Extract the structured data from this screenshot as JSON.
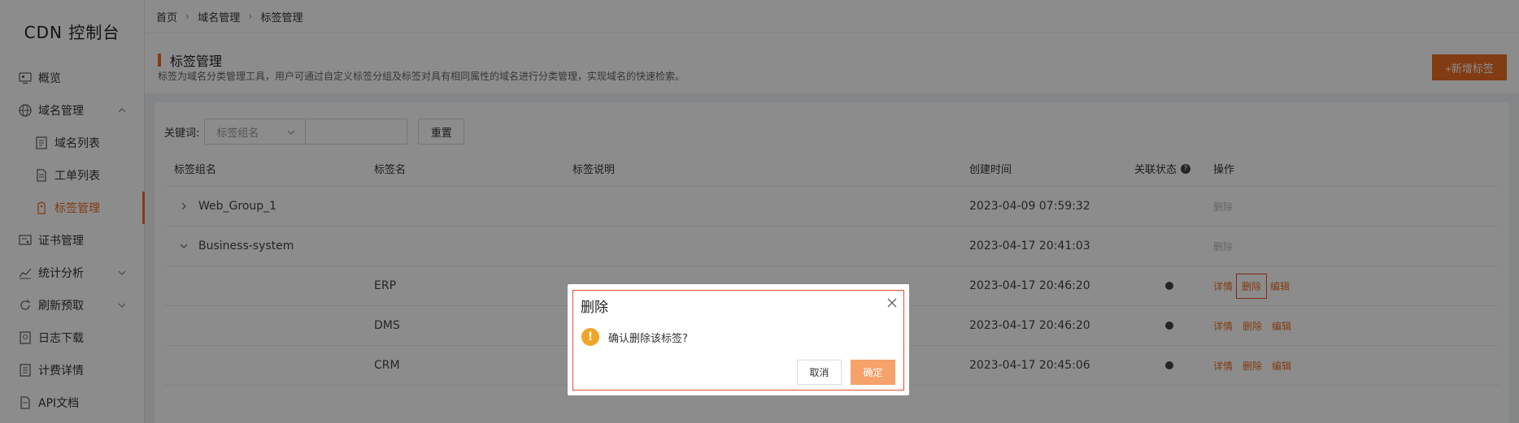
{
  "brand": "CDN 控制台",
  "sidebar": {
    "items": [
      {
        "label": "概览",
        "icon": "monitor-icon"
      },
      {
        "label": "域名管理",
        "icon": "globe-icon"
      },
      {
        "label": "域名列表",
        "icon": "list-icon"
      },
      {
        "label": "工单列表",
        "icon": "document-icon"
      },
      {
        "label": "标签管理",
        "icon": "tag-icon"
      },
      {
        "label": "证书管理",
        "icon": "certificate-icon"
      },
      {
        "label": "统计分析",
        "icon": "chart-icon"
      },
      {
        "label": "刷新预取",
        "icon": "refresh-icon"
      },
      {
        "label": "日志下载",
        "icon": "log-icon"
      },
      {
        "label": "计费详情",
        "icon": "billing-icon"
      },
      {
        "label": "API文档",
        "icon": "api-doc-icon"
      }
    ]
  },
  "breadcrumb": [
    "首页",
    "域名管理",
    "标签管理"
  ],
  "header": {
    "title": "标签管理",
    "description": "标签为域名分类管理工具，用户可通过自定义标签分组及标签对具有相同属性的域名进行分类管理，实现域名的快速检索。",
    "add_button": "+新增标签"
  },
  "filter": {
    "label": "关键词:",
    "select_placeholder": "标签组名",
    "input_value": "",
    "reset": "重置"
  },
  "table": {
    "columns": [
      "标签组名",
      "标签名",
      "标签说明",
      "创建时间",
      "关联状态",
      "操作"
    ],
    "help_mark": "?",
    "rows": [
      {
        "group": "Web_Group_1",
        "name": "",
        "desc": "",
        "time": "2023-04-09 07:59:32",
        "ops": [
          "删除"
        ]
      },
      {
        "group": "Business-system",
        "name": "",
        "desc": "",
        "time": "2023-04-17 20:41:03",
        "ops": [
          "删除"
        ]
      },
      {
        "group": "",
        "name": "ERP",
        "desc": "",
        "time": "2023-04-17 20:46:20",
        "ops": [
          "详情",
          "删除",
          "编辑"
        ]
      },
      {
        "group": "",
        "name": "DMS",
        "desc": "",
        "time": "2023-04-17 20:46:20",
        "ops": [
          "详情",
          "删除",
          "编辑"
        ]
      },
      {
        "group": "",
        "name": "CRM",
        "desc": "",
        "time": "2023-04-17 20:45:06",
        "ops": [
          "详情",
          "删除",
          "编辑"
        ]
      }
    ]
  },
  "modal": {
    "title": "删除",
    "icon_mark": "!",
    "message": "确认删除该标签?",
    "cancel": "取消",
    "ok": "确定"
  },
  "colors": {
    "accent": "#ed6d24",
    "warning": "#f0a52a",
    "highlight": "#e2502a"
  }
}
